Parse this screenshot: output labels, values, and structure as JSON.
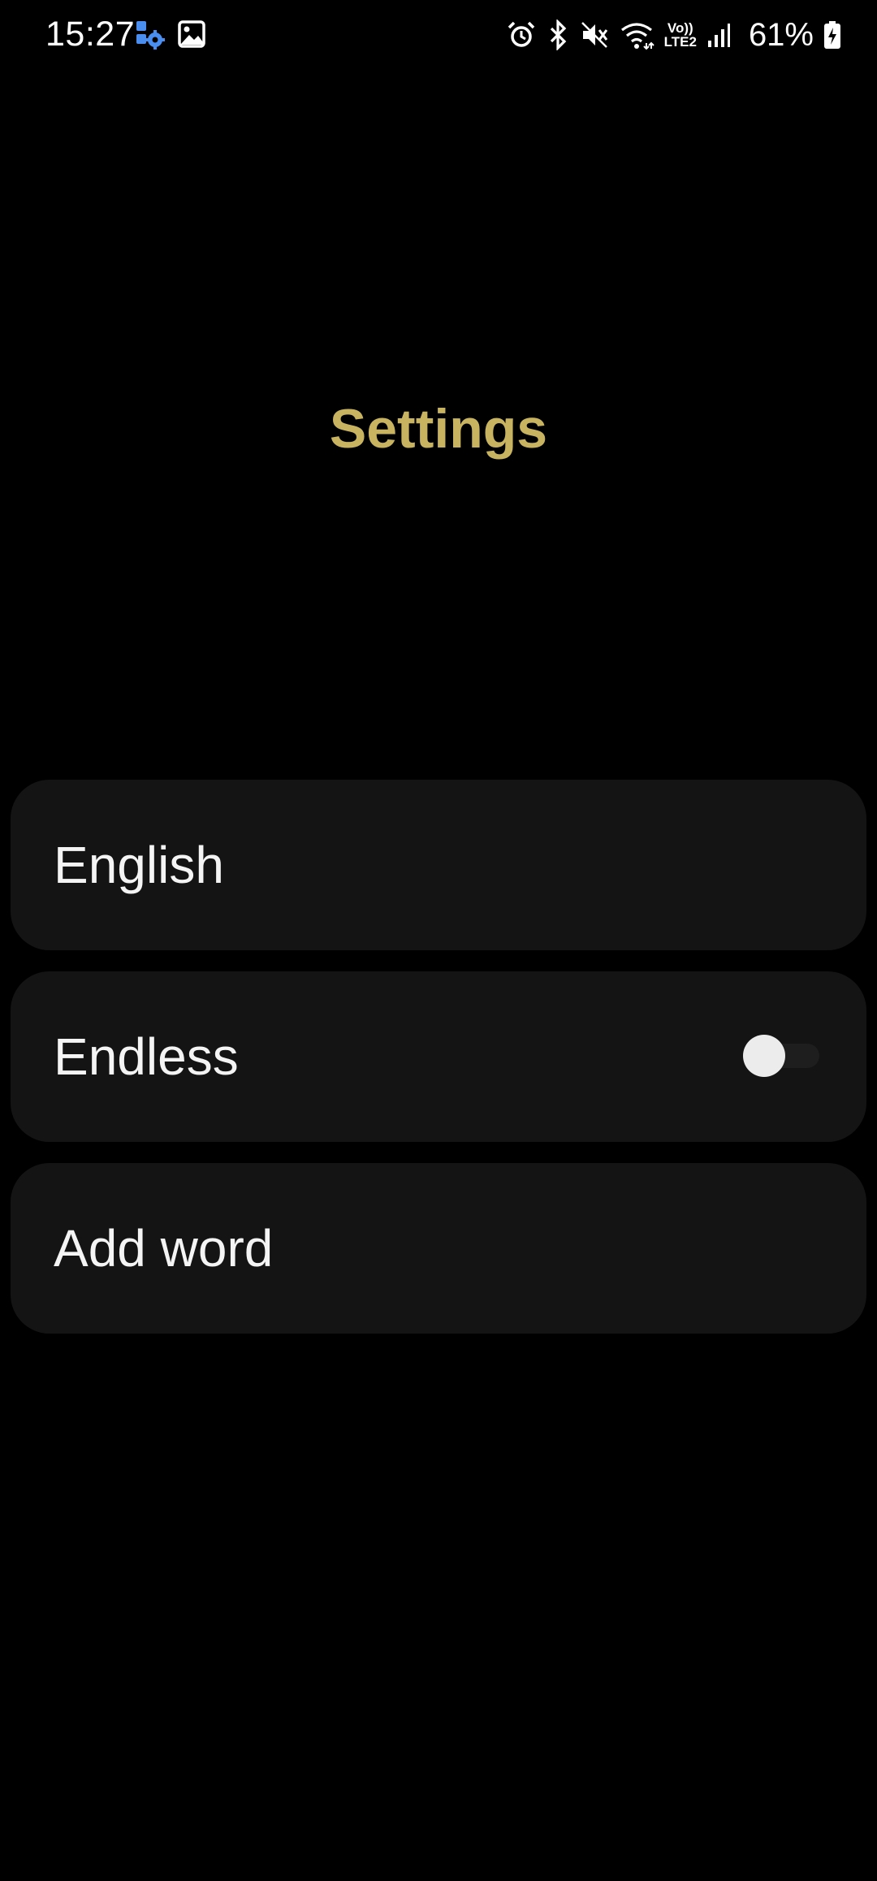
{
  "status_bar": {
    "time": "15:27",
    "left_icons": [
      "automation-gear-icon",
      "gallery-image-icon"
    ],
    "right_icons": [
      "alarm-icon",
      "bluetooth-icon",
      "mute-icon",
      "wifi-icon",
      "volte-lte2-icon",
      "signal-icon"
    ],
    "network_label_top": "Vo))",
    "network_label_bottom": "LTE2",
    "battery_percent": "61%",
    "battery_icon": "battery-charging-icon"
  },
  "header": {
    "title": "Settings"
  },
  "colors": {
    "title_accent": "#c8b460",
    "row_background": "#141414",
    "background": "#000000",
    "status_blue_icon": "#4a8ff0"
  },
  "settings": {
    "items": [
      {
        "label": "English",
        "type": "link"
      },
      {
        "label": "Endless",
        "type": "toggle",
        "toggle_on": false
      },
      {
        "label": "Add word",
        "type": "link"
      }
    ]
  }
}
